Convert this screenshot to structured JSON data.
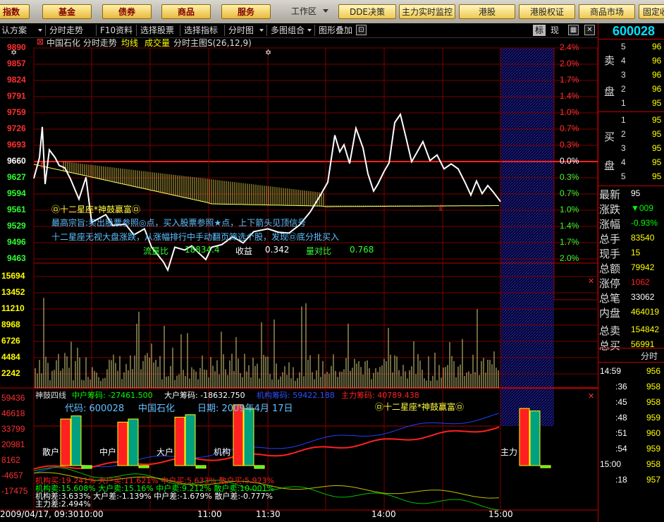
{
  "top_bar": {
    "buttons": [
      "指数",
      "基金",
      "债券",
      "商品",
      "服务"
    ],
    "workspace_label": "工作区",
    "small_buttons": [
      "DDE决策",
      "主力实时监控",
      "港股",
      "港股权证",
      "商品市场",
      "固定收"
    ]
  },
  "toolbar": {
    "items": [
      "认方案",
      "分时走势",
      "F10资料",
      "选择股票",
      "选择指标",
      "分时图",
      "多图组合",
      "图形叠加"
    ],
    "tab_biao": "标",
    "tab_shi": "现"
  },
  "stock": {
    "code": "600028",
    "name": "中国石化",
    "chart_title": "中国石化 分时走势",
    "legend_avg": "均线",
    "legend_vol": "成交量",
    "params": "分时主图S(26,12,9)"
  },
  "annotations": {
    "line1": "㉤十二星座*神鼓赢富㉤",
    "line2": "最高宗旨:卖出股票参照◎点，买入股票参照★点，上下箭头见顶信号",
    "line3": "十二星座无视大盘涨跌，从涨幅排行中手动翻页筛选个股，发现㉤底分批买入",
    "vol_label": "流量比",
    "vol_value": "18834.4",
    "close_label": "收益",
    "close_value": "0.342",
    "ratio_label": "量对比",
    "ratio_value": "0.768"
  },
  "price_axis": [
    "9890",
    "9857",
    "9824",
    "9791",
    "9759",
    "9726",
    "9693",
    "9660",
    "9627",
    "9594",
    "9561",
    "9529",
    "9496",
    "9463"
  ],
  "pct_axis": [
    "2.4%",
    "2.0%",
    "1.7%",
    "1.4%",
    "1.0%",
    "0.7%",
    "0.3%",
    "0.0%",
    "0.3%",
    "0.7%",
    "1.0%",
    "1.4%",
    "1.7%",
    "2.0%"
  ],
  "volume_axis": [
    "15694",
    "13452",
    "11210",
    "8968",
    "6726",
    "4484",
    "2242"
  ],
  "indicator": {
    "header_name": "神鼓四线",
    "header_items": [
      {
        "label": "中户筹码: -27461.500",
        "color": "#00ff00"
      },
      {
        "label": "大户筹码: -18632.750",
        "color": "#ffffff"
      },
      {
        "label": "机构筹码: 59422.188",
        "color": "#3050ff"
      },
      {
        "label": "主力筹码: 40789.438",
        "color": "#ff2020"
      }
    ],
    "info_code": "代码: 600028",
    "info_name": "中国石化",
    "info_date": "日期: 2009年4月 17日",
    "info_brand": "㉤十二星座*神鼓赢富㉤",
    "axis": [
      "59436",
      "46618",
      "33799",
      "20981",
      "8162",
      "-4657",
      "-17475"
    ],
    "bar_groups": [
      {
        "label": "散户",
        "values": [
          0.75,
          0.8,
          0.2
        ]
      },
      {
        "label": "中户",
        "values": [
          0.7,
          0.75,
          0.15
        ]
      },
      {
        "label": "大户",
        "values": [
          0.78,
          0.82,
          0.18
        ]
      },
      {
        "label": "机构",
        "values": [
          0.98,
          0.92,
          0.2
        ]
      },
      {
        "label": "主力",
        "values": [
          0.92,
          0.88,
          0.08
        ]
      }
    ],
    "bottom_lines": [
      {
        "text": "机构买:19.241%  大户买:11.621%  中户买:5.633%  散户买:5.923%",
        "color": "#ff2020"
      },
      {
        "text": "机构卖:15.608%  大户卖:15.16%  中户卖:9.212%  散户卖:10.001%",
        "color": "#00ff00"
      },
      {
        "text": "机构差:3.633%  大户差:-1.139%  中户差:-1.679%  散户差:-0.777%",
        "color": "#ffffff"
      },
      {
        "text": "主力差:2.494%",
        "color": "#ffffff"
      }
    ]
  },
  "time_axis": [
    "2009/04/17, 09:30",
    "10:00",
    "11:00",
    "11:30",
    "14:00",
    "15:00"
  ],
  "right_panel": {
    "code": "600028",
    "sell_label_1": "卖",
    "sell_label_2": "盘",
    "buy_label_1": "买",
    "buy_label_2": "盘",
    "sell_levels": [
      {
        "level": "5",
        "price": "96"
      },
      {
        "level": "4",
        "price": "96"
      },
      {
        "level": "3",
        "price": "96"
      },
      {
        "level": "2",
        "price": "96"
      },
      {
        "level": "1",
        "price": "95"
      }
    ],
    "buy_levels": [
      {
        "level": "1",
        "price": "95"
      },
      {
        "level": "2",
        "price": "95"
      },
      {
        "level": "3",
        "price": "95"
      },
      {
        "level": "4",
        "price": "95"
      },
      {
        "level": "5",
        "price": "95"
      }
    ],
    "stats": [
      {
        "label": "最新",
        "value": "95",
        "color": "#ffffff"
      },
      {
        "label": "涨跌",
        "value": "▼009",
        "color": "#00ff00"
      },
      {
        "label": "涨幅",
        "value": "-0.93%",
        "color": "#00ff00"
      },
      {
        "label": "总手",
        "value": "83540",
        "color": "#ffff00"
      },
      {
        "label": "现手",
        "value": "15",
        "color": "#ffff00"
      },
      {
        "label": "总额",
        "value": "79942",
        "color": "#ffff00"
      },
      {
        "label": "涨停",
        "value": "1062",
        "color": "#ff2020"
      },
      {
        "label": "总笔",
        "value": "33062",
        "color": "#ffffff"
      },
      {
        "label": "内盘",
        "value": "464019",
        "color": "#ffff00"
      },
      {
        "label": "总卖",
        "value": "154842",
        "color": "#ffff00"
      },
      {
        "label": "总买",
        "value": "56991",
        "color": "#ffff00"
      }
    ],
    "ticks_header": "分时",
    "ticks": [
      {
        "time": "14:59",
        "price": "956"
      },
      {
        "time": ":36",
        "price": "958"
      },
      {
        "time": ":45",
        "price": "958"
      },
      {
        "time": ":48",
        "price": "959"
      },
      {
        "time": ":51",
        "price": "960"
      },
      {
        "time": ":54",
        "price": "959"
      },
      {
        "time": "15:00",
        "price": "958"
      },
      {
        "time": ":18",
        "price": "957"
      }
    ]
  }
}
